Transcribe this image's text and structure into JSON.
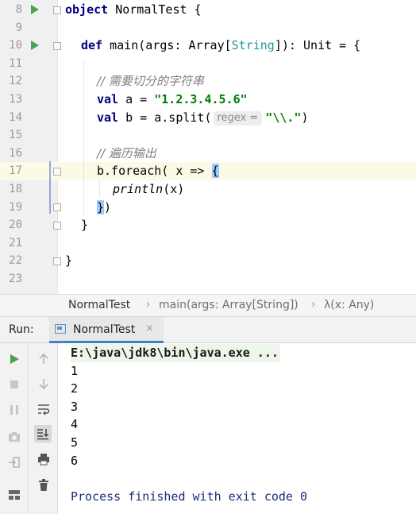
{
  "editor": {
    "lines": [
      {
        "num": "8"
      },
      {
        "num": "9"
      },
      {
        "num": "10"
      },
      {
        "num": "11"
      },
      {
        "num": "12"
      },
      {
        "num": "13"
      },
      {
        "num": "14"
      },
      {
        "num": "15"
      },
      {
        "num": "16"
      },
      {
        "num": "17"
      },
      {
        "num": "18"
      },
      {
        "num": "19"
      },
      {
        "num": "20"
      },
      {
        "num": "21"
      },
      {
        "num": "22"
      },
      {
        "num": "23"
      }
    ],
    "code": {
      "l8_kw": "object",
      "l8_rest": " NormalTest {",
      "l10_kw": "def",
      "l10_a": " main(args: Array[",
      "l10_type": "String",
      "l10_b": "]): Unit = {",
      "l12_comment": "// 需要切分的字符串",
      "l13_kw": "val",
      "l13_a": " a = ",
      "l13_str": "\"1.2.3.4.5.6\"",
      "l14_kw": "val",
      "l14_a": " b = a.split(",
      "l14_hint": "regex =",
      "l14_str": "\"\\\\.\"",
      "l14_b": ")",
      "l16_comment": "// 遍历输出",
      "l17_a": "b.foreach( x => ",
      "l17_brace": "{",
      "l18_ital": "println",
      "l18_a": "(x)",
      "l19_brace": "}",
      "l19_a": ")",
      "l20": "}",
      "l22": "}"
    }
  },
  "breadcrumb": {
    "items": [
      "NormalTest",
      "main(args: Array[String])",
      "λ(x: Any)"
    ],
    "separator": "›"
  },
  "run_panel": {
    "label": "Run:",
    "tab_label": "NormalTest",
    "tab_close": "×"
  },
  "console": {
    "command": "E:\\java\\jdk8\\bin\\java.exe ...",
    "output": [
      "1",
      "2",
      "3",
      "4",
      "5",
      "6"
    ],
    "exit_message": "Process finished with exit code 0"
  },
  "icons": {
    "run": "run-icon",
    "stop": "stop-icon",
    "pause": "pause-icon",
    "screenshot": "camera-icon",
    "login": "login-icon",
    "layout": "layout-icon",
    "up": "arrow-up-icon",
    "down": "arrow-down-icon",
    "wrap": "soft-wrap-icon",
    "scroll": "scroll-to-end-icon",
    "print": "print-icon",
    "trash": "trash-icon"
  },
  "colors": {
    "keyword": "#000080",
    "string": "#008000",
    "type": "#20999d",
    "comment": "#808080",
    "run_green": "#4ba24c",
    "exit_text": "#1c2d7a",
    "current_line": "#fcfae6"
  }
}
